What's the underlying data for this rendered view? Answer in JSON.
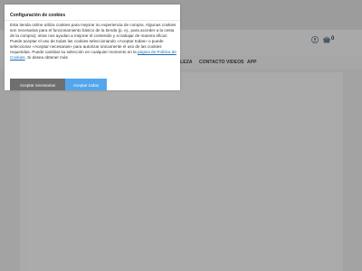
{
  "modal": {
    "title": "Configuración de cookies",
    "text_main": "Esta tienda online utiliza cookies para mejorar su experiencia de compra. Algunas cookies son necesarias para el funcionamiento básico de la tienda (p. ej., para acceder a la cesta de la compra); otras nos ayudan a mejorar el contenido y a trabajar de manera eficaz. Puede aceptar el uso de todas las cookies seleccionando «Aceptar todas» o puede seleccionar «Aceptar necesarias» para autorizar únicamente el uso de las cookies requeridas. Puede cambiar su selección en cualquier momento en la",
    "link_text": "página de Política de Cookies",
    "text_after": ". Si desea obtener más",
    "btn_necessary": "Aceptar necesarias",
    "btn_all": "Aceptar todas"
  },
  "nav": {
    "items": [
      "LLEZA",
      "CONTACTO",
      "VIDEOS",
      "APP"
    ]
  },
  "header": {
    "cart_count": "0"
  },
  "colors": {
    "overlay": "#a3a3a3",
    "accept_all": "#53a6ec",
    "accept_necessary": "#6f6f6f",
    "link": "#1a6fb5"
  },
  "icons": {
    "user": "user-icon",
    "cart": "cart-icon"
  }
}
